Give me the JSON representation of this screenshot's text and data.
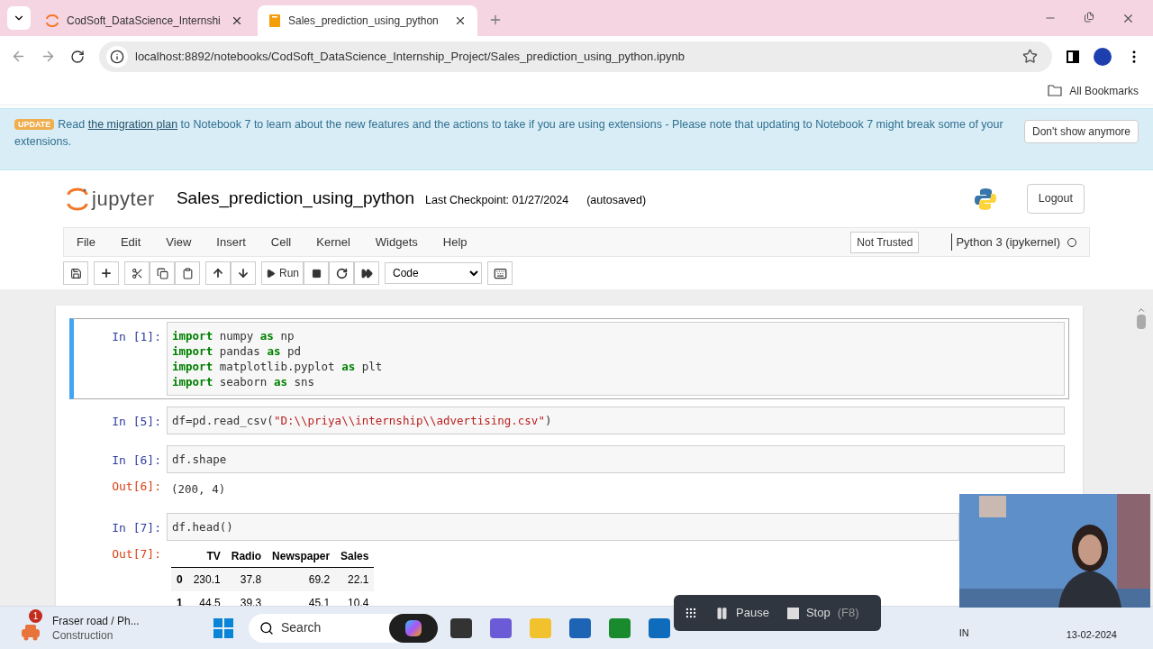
{
  "browser": {
    "tabs": [
      {
        "title": "CodSoft_DataScience_Internshi",
        "selected": false
      },
      {
        "title": "Sales_prediction_using_python",
        "selected": true
      }
    ],
    "url": "localhost:8892/notebooks/CodSoft_DataScience_Internship_Project/Sales_prediction_using_python.ipynb",
    "bookmarks_label": "All Bookmarks"
  },
  "banner": {
    "badge": "UPDATE",
    "text_before": "Read",
    "link": "the migration plan",
    "text_after": "to Notebook 7 to learn about the new features and the actions to take if you are using extensions - Please note that updating to Notebook 7 might break some of your extensions.",
    "button": "Don't show anymore"
  },
  "header": {
    "logo_text": "jupyter",
    "notebook_name": "Sales_prediction_using_python",
    "checkpoint": "Last Checkpoint: 01/27/2024",
    "autosaved": "(autosaved)",
    "logout": "Logout"
  },
  "menu": [
    "File",
    "Edit",
    "View",
    "Insert",
    "Cell",
    "Kernel",
    "Widgets",
    "Help"
  ],
  "trust": "Not Trusted",
  "kernel": "Python 3 (ipykernel)",
  "toolbar": {
    "run": "Run",
    "cell_type": "Code"
  },
  "cells": [
    {
      "prompt": "In [1]:",
      "selected": true,
      "lines": [
        [
          {
            "kind": "kw",
            "text": "import"
          },
          {
            "kind": "plain",
            "text": " numpy "
          },
          {
            "kind": "kw",
            "text": "as"
          },
          {
            "kind": "plain",
            "text": " np"
          }
        ],
        [
          {
            "kind": "kw",
            "text": "import"
          },
          {
            "kind": "plain",
            "text": " pandas "
          },
          {
            "kind": "kw",
            "text": "as"
          },
          {
            "kind": "plain",
            "text": " pd"
          }
        ],
        [
          {
            "kind": "kw",
            "text": "import"
          },
          {
            "kind": "plain",
            "text": " matplotlib.pyplot "
          },
          {
            "kind": "kw",
            "text": "as"
          },
          {
            "kind": "plain",
            "text": " plt"
          }
        ],
        [
          {
            "kind": "kw",
            "text": "import"
          },
          {
            "kind": "plain",
            "text": " seaborn "
          },
          {
            "kind": "kw",
            "text": "as"
          },
          {
            "kind": "plain",
            "text": " sns"
          }
        ]
      ]
    },
    {
      "prompt": "In [5]:",
      "selected": false,
      "lines": [
        [
          {
            "kind": "plain",
            "text": "df=pd.read_csv("
          },
          {
            "kind": "str",
            "text": "\"D:\\\\priya\\\\internship\\\\advertising.csv\""
          },
          {
            "kind": "plain",
            "text": ")"
          }
        ]
      ]
    },
    {
      "prompt": "In [6]:",
      "selected": false,
      "lines": [
        [
          {
            "kind": "plain",
            "text": "df.shape"
          }
        ]
      ],
      "output": {
        "prompt": "Out[6]:",
        "text": "(200, 4)"
      }
    },
    {
      "prompt": "In [7]:",
      "selected": false,
      "lines": [
        [
          {
            "kind": "plain",
            "text": "df.head()"
          }
        ]
      ],
      "output": {
        "prompt": "Out[7]:",
        "table": {
          "columns": [
            "",
            "TV",
            "Radio",
            "Newspaper",
            "Sales"
          ],
          "rows": [
            [
              "0",
              "230.1",
              "37.8",
              "69.2",
              "22.1"
            ],
            [
              "1",
              "44.5",
              "39.3",
              "45.1",
              "10.4"
            ]
          ]
        }
      }
    }
  ],
  "recorder": {
    "pause": "Pause",
    "stop": "Stop",
    "stop_key": "(F8)"
  },
  "taskbar": {
    "weather_title": "Fraser road / Ph...",
    "weather_sub": "Construction",
    "weather_badge": "1",
    "search": "Search",
    "lang": "IN",
    "date": "13-02-2024"
  }
}
